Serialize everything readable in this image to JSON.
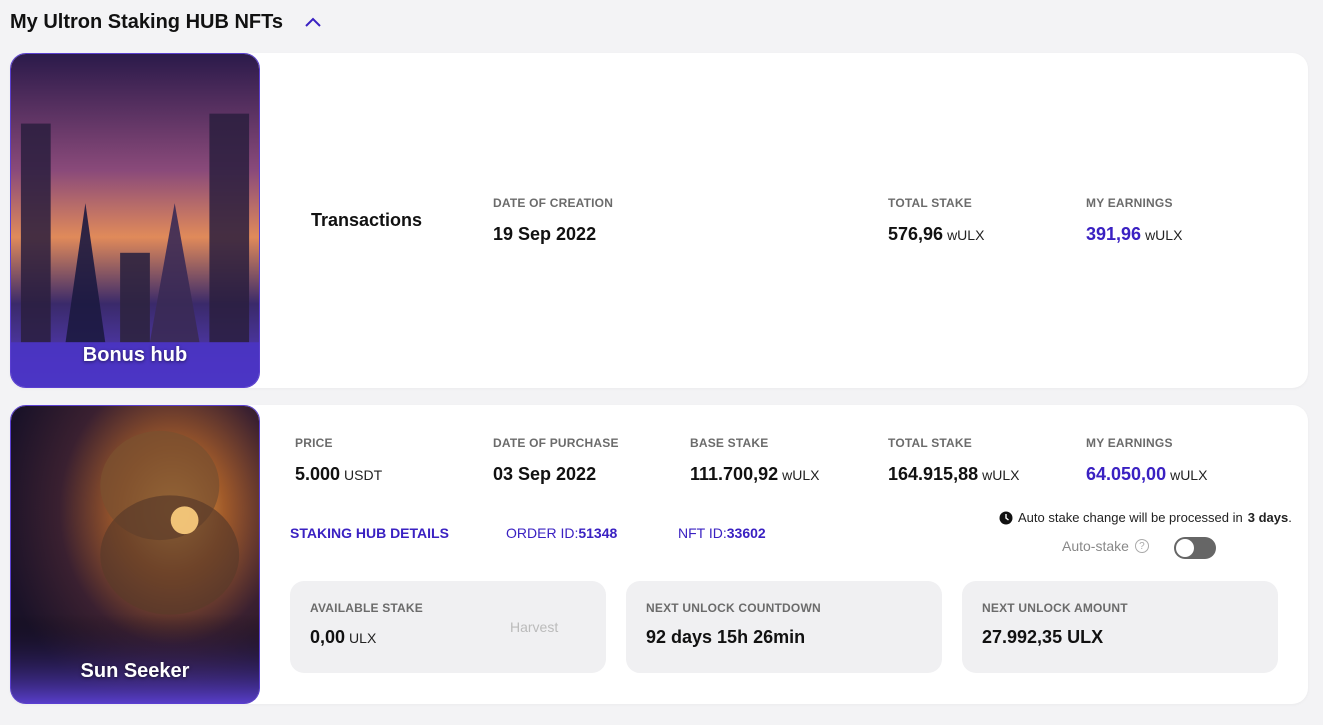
{
  "header": {
    "title": "My Ultron Staking HUB NFTs",
    "collapse_icon": "chevron-up-icon"
  },
  "cards": [
    {
      "nft_name": "Bonus hub",
      "type_label": "Transactions",
      "date_label": "DATE OF CREATION",
      "date_value": "19 Sep 2022",
      "total_stake_label": "TOTAL STAKE",
      "total_stake_value": "576,96",
      "total_stake_unit": "wULX",
      "earnings_label": "MY EARNINGS",
      "earnings_value": "391,96",
      "earnings_unit": "wULX"
    },
    {
      "nft_name": "Sun Seeker",
      "price_label": "PRICE",
      "price_value": "5.000",
      "price_unit": "USDT",
      "date_label": "DATE OF PURCHASE",
      "date_value": "03 Sep 2022",
      "base_stake_label": "BASE STAKE",
      "base_stake_value": "111.700,92",
      "base_stake_unit": "wULX",
      "total_stake_label": "TOTAL STAKE",
      "total_stake_value": "164.915,88",
      "total_stake_unit": "wULX",
      "earnings_label": "MY EARNINGS",
      "earnings_value": "64.050,00",
      "earnings_unit": "wULX",
      "details_link": "STAKING HUB DETAILS",
      "order_id_label": "ORDER ID:",
      "order_id_value": "51348",
      "nft_id_label": "NFT ID:",
      "nft_id_value": "33602",
      "notice_text": "Auto stake change will be processed in",
      "notice_days": "3 days",
      "notice_end": ".",
      "autostake_label": "Auto-stake",
      "autostake_on": false,
      "available_label": "AVAILABLE STAKE",
      "available_value": "0,00",
      "available_unit": "ULX",
      "harvest_label": "Harvest",
      "countdown_label": "NEXT UNLOCK COUNTDOWN",
      "countdown_value": "92 days 15h 26min",
      "unlock_amount_label": "NEXT UNLOCK AMOUNT",
      "unlock_amount_value": "27.992,35 ULX"
    }
  ],
  "colors": {
    "accent": "#3a21c2",
    "card_bg": "#ffffff",
    "page_bg": "#f3f3f5"
  }
}
